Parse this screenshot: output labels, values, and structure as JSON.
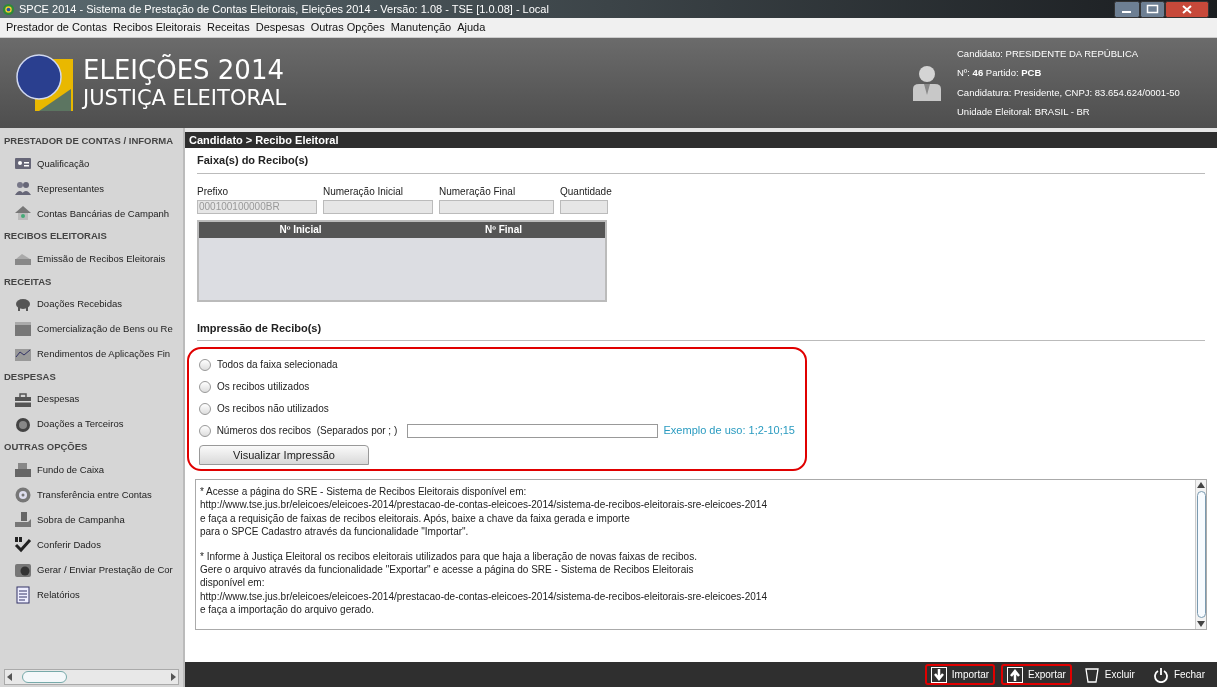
{
  "window": {
    "title": "SPCE 2014 - Sistema de Prestação de Contas Eleitorais, Eleições 2014 - Versão: 1.08  -  TSE [1.0.08] - Local"
  },
  "menu": [
    "Prestador de Contas",
    "Recibos Eleitorais",
    "Receitas",
    "Despesas",
    "Outras Opções",
    "Manutenção",
    "Ajuda"
  ],
  "header": {
    "title": "ELEIÇÕES 2014",
    "subtitle": "JUSTIÇA ELEITORAL",
    "candidate": [
      "Candidato: PRESIDENTE DA REPÚBLICA",
      "Nº: **46** Partido: **PCB**",
      "Candidatura: Presidente, CNPJ: 83.654.624/0001-50",
      "Unidade Eleitoral: BRASIL - BR"
    ]
  },
  "sidebar": [
    {
      "heading": "PRESTADOR DE CONTAS / INFORMA",
      "items": [
        {
          "label": "Qualificação"
        },
        {
          "label": "Representantes"
        },
        {
          "label": "Contas Bancárias de Campanh"
        }
      ]
    },
    {
      "heading": "RECIBOS ELEITORAIS",
      "items": [
        {
          "label": "Emissão de Recibos Eleitorais"
        }
      ]
    },
    {
      "heading": "RECEITAS",
      "items": [
        {
          "label": "Doações Recebidas"
        },
        {
          "label": "Comercialização de Bens ou Re"
        },
        {
          "label": "Rendimentos de Aplicações Fin"
        }
      ]
    },
    {
      "heading": "DESPESAS",
      "items": [
        {
          "label": "Despesas"
        },
        {
          "label": "Doações a Terceiros"
        }
      ]
    },
    {
      "heading": "OUTRAS OPÇÕES",
      "items": [
        {
          "label": "Fundo de Caixa"
        },
        {
          "label": "Transferência entre Contas"
        },
        {
          "label": "Sobra de Campanha"
        },
        {
          "label": "Conferir Dados"
        },
        {
          "label": "Gerar / Enviar Prestação de Cor"
        },
        {
          "label": "Relatórios"
        }
      ]
    }
  ],
  "breadcrumb": "Candidato > Recibo Eleitoral",
  "faixas": {
    "title": "Faixa(s) do Recibo(s)",
    "fields": [
      {
        "label": "Prefixo",
        "value": "000100100000BR"
      },
      {
        "label": "Numeração Inicial"
      },
      {
        "label": "Numeração Final"
      },
      {
        "label": "Quantidade"
      }
    ],
    "table": {
      "columns": [
        "Nº Inicial",
        "Nº Final"
      ]
    }
  },
  "impressao": {
    "title": "Impressão de Recibo(s)",
    "highlighted": true,
    "options": [
      {
        "label": "Todos da faixa selecionada",
        "selected": false
      },
      {
        "label": "Os recibos utilizados",
        "selected": false
      },
      {
        "label": "Os recibos não utilizados",
        "selected": false
      },
      {
        "label": "Números dos recibos  (Separados por ; )",
        "selected": false,
        "kind": "input"
      }
    ],
    "example": "Exemplo de uso: 1;2-10;15",
    "button": "Visualizar Impressão"
  },
  "info": [
    [
      "* Acesse a página do SRE - Sistema de Recibos Eleitorais disponível em:",
      "http://www.tse.jus.br/eleicoes/eleicoes-2014/prestacao-de-contas-eleicoes-2014/sistema-de-recibos-eleitorais-sre-eleicoes-2014",
      "e faça a requisição de faixas de recibos eleitorais. Após, baixe a chave da faixa gerada e importe",
      "para o SPCE Cadastro através da funcionalidade \"Importar\"."
    ],
    [
      "* Informe à Justiça Eleitoral os recibos eleitorais utilizados para que haja a liberação de novas faixas de recibos.",
      "Gere o arquivo através da funcionalidade \"Exportar\" e acesse a página do SRE - Sistema de Recibos Eleitorais",
      "disponível em:",
      "http://www.tse.jus.br/eleicoes/eleicoes-2014/prestacao-de-contas-eleicoes-2014/sistema-de-recibos-eleitorais-sre-eleicoes-2014",
      "e faça a importação do arquivo gerado."
    ]
  ],
  "actions": [
    {
      "label": "Importar",
      "highlighted": true
    },
    {
      "label": "Exportar",
      "highlighted": true
    },
    {
      "label": "Excluir",
      "highlighted": false
    },
    {
      "label": "Fechar",
      "highlighted": false
    }
  ]
}
